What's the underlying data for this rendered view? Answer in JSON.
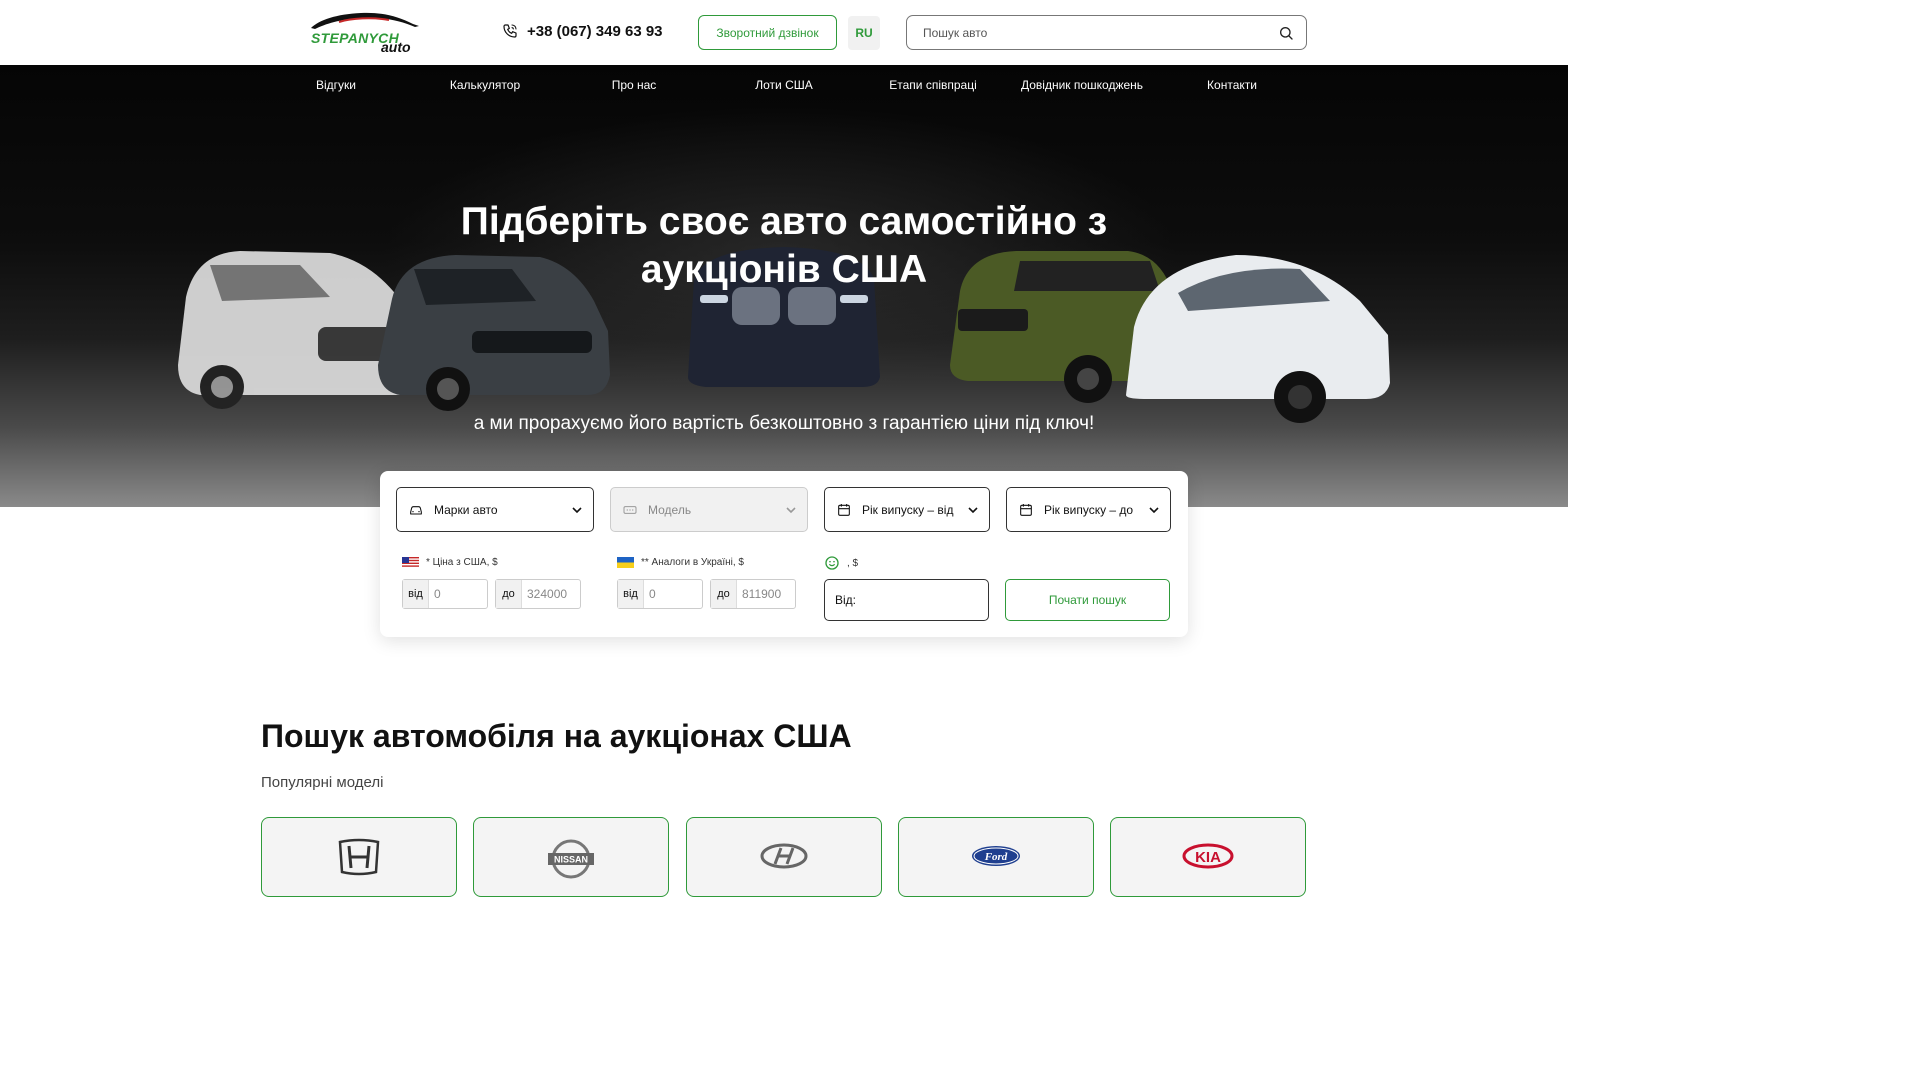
{
  "header": {
    "logo_line1": "STEPANYCH",
    "logo_line2": "auto",
    "phone": "+38 (067) 349 63 93",
    "callback_label": "Зворотний дзвінок",
    "lang_label": "RU",
    "search_placeholder": "Пошук авто"
  },
  "nav": {
    "items": [
      {
        "label": "Відгуки"
      },
      {
        "label": "Калькулятор"
      },
      {
        "label": "Про нас"
      },
      {
        "label": "Лоти США"
      },
      {
        "label": "Етапи співпраці"
      },
      {
        "label": "Довідник пошкоджень"
      },
      {
        "label": "Контакти"
      }
    ]
  },
  "hero": {
    "title": "Підберіть своє авто самостійно з аукціонів США",
    "subtitle": "а ми прорахуємо його вартість безкоштовно з гарантією ціни під ключ!"
  },
  "filter": {
    "brand_label": "Марки авто",
    "model_label": "Модель",
    "year_from_label": "Рік випуску – від",
    "year_to_label": "Рік випуску – до",
    "usa_price_label": "* Ціна з США, $",
    "ua_price_label": "** Аналоги в Україні, $",
    "third_label": ", $",
    "usa_from_prefix": "від",
    "usa_from_value": "0",
    "usa_to_prefix": "до",
    "usa_to_value": "324000",
    "ua_from_prefix": "від",
    "ua_from_value": "0",
    "ua_to_prefix": "до",
    "ua_to_value": "811900",
    "from_box_label": "Від:",
    "search_button": "Почати пошук"
  },
  "section": {
    "title": "Пошук автомобіля на аукціонах США",
    "subtitle": "Популярні моделі",
    "brands": [
      "honda-logo",
      "nissan-logo",
      "hyundai-logo",
      "ford-logo",
      "kia-logo"
    ],
    "brand_logo_texts": {
      "nissan": "NISSAN",
      "ford": "Ford",
      "kia": "KIA"
    }
  },
  "colors": {
    "accent": "#2f9a3a",
    "hero_dark": "#050505",
    "text": "#111111"
  }
}
